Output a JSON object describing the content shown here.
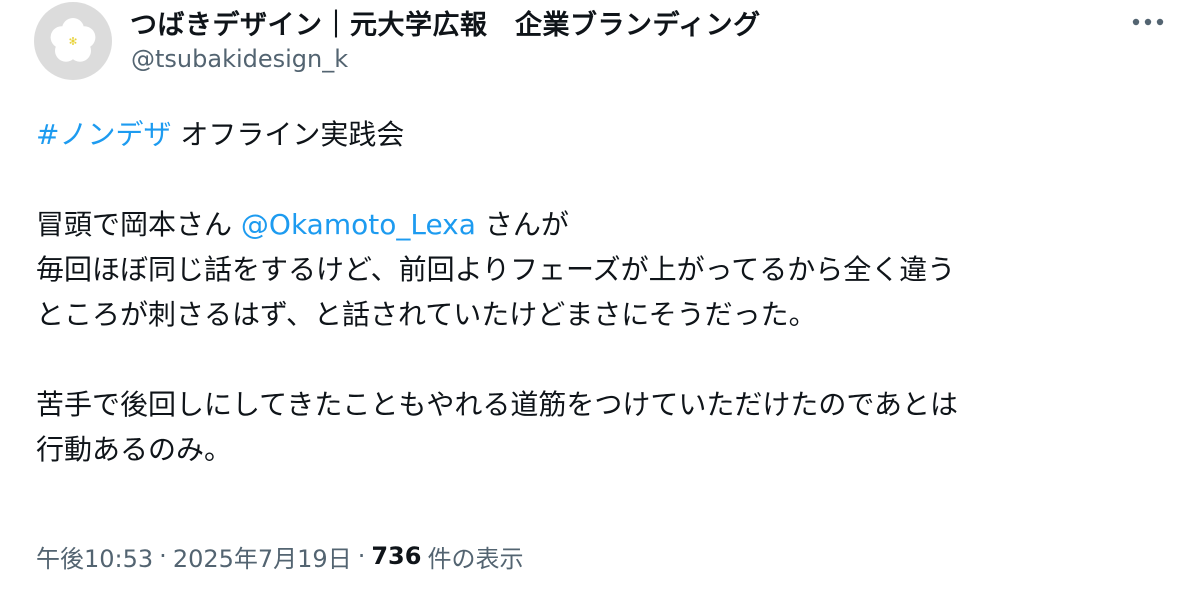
{
  "author": {
    "display_name": "つばきデザイン｜元大学広報　企業ブランディング",
    "handle": "@tsubakidesign_k",
    "avatar_icon": "camellia-flower-icon"
  },
  "more_icon": "more-horizontal-icon",
  "tweet": {
    "hashtag": "#ノンデザ",
    "line1_rest": " オフライン実践会",
    "line2_before": "冒頭で岡本さん ",
    "mention": "@Okamoto_Lexa",
    "line2_after": " さんが",
    "line3": "毎回ほぼ同じ話をするけど、前回よりフェーズが上がってるから全く違う",
    "line4": "ところが刺さるはず、と話されていたけどまさにそうだった。",
    "line5": "苦手で後回しにしてきたこともやれる道筋をつけていただけたのであとは",
    "line6": "行動あるのみ。"
  },
  "meta": {
    "time": "午後10:53",
    "dot1": "·",
    "date": "2025年7月19日",
    "dot2": "·",
    "views_count": "736",
    "views_label": "件の表示"
  },
  "colors": {
    "link": "#1d9bf0",
    "text": "#0f1419",
    "secondary": "#536471",
    "avatar_bg": "#dcdcdc"
  }
}
